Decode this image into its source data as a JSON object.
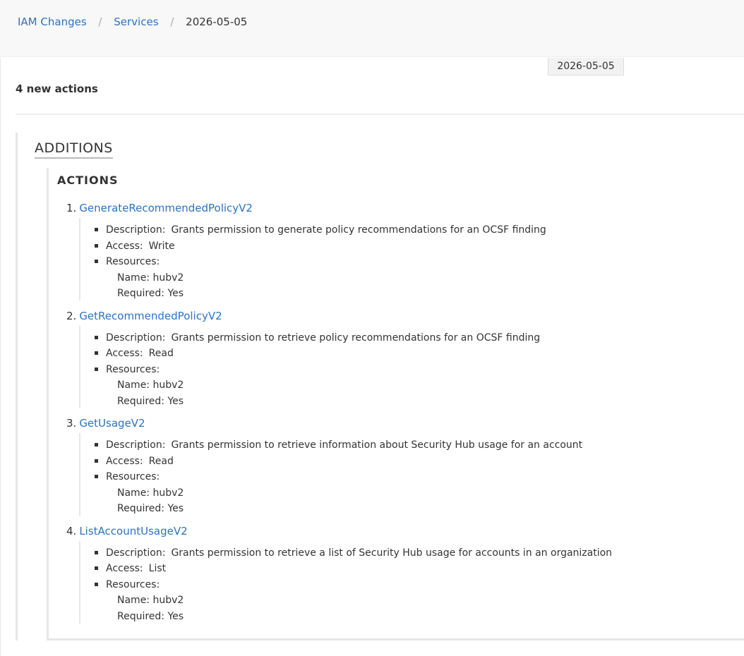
{
  "breadcrumb": {
    "items": [
      "IAM Changes",
      "Services"
    ],
    "separator": "/",
    "current": "2026-05-05"
  },
  "date_badge": "2026-05-05",
  "summary": "4 new actions",
  "additions_title": "ADDITIONS",
  "actions_title": "ACTIONS",
  "labels": {
    "description": "Description:",
    "access": "Access:",
    "resources": "Resources:",
    "name": "Name:",
    "required": "Required:"
  },
  "actions": [
    {
      "num": "1.",
      "name": "GenerateRecommendedPolicyV2",
      "description": "Grants permission to generate policy recommendations for an OCSF finding",
      "access": "Write",
      "resource_name": "hubv2",
      "required": "Yes"
    },
    {
      "num": "2.",
      "name": "GetRecommendedPolicyV2",
      "description": "Grants permission to retrieve policy recommendations for an OCSF finding",
      "access": "Read",
      "resource_name": "hubv2",
      "required": "Yes"
    },
    {
      "num": "3.",
      "name": "GetUsageV2",
      "description": "Grants permission to retrieve information about Security Hub usage for an account",
      "access": "Read",
      "resource_name": "hubv2",
      "required": "Yes"
    },
    {
      "num": "4.",
      "name": "ListAccountUsageV2",
      "description": "Grants permission to retrieve a list of Security Hub usage for accounts in an organization",
      "access": "List",
      "resource_name": "hubv2",
      "required": "Yes"
    }
  ]
}
